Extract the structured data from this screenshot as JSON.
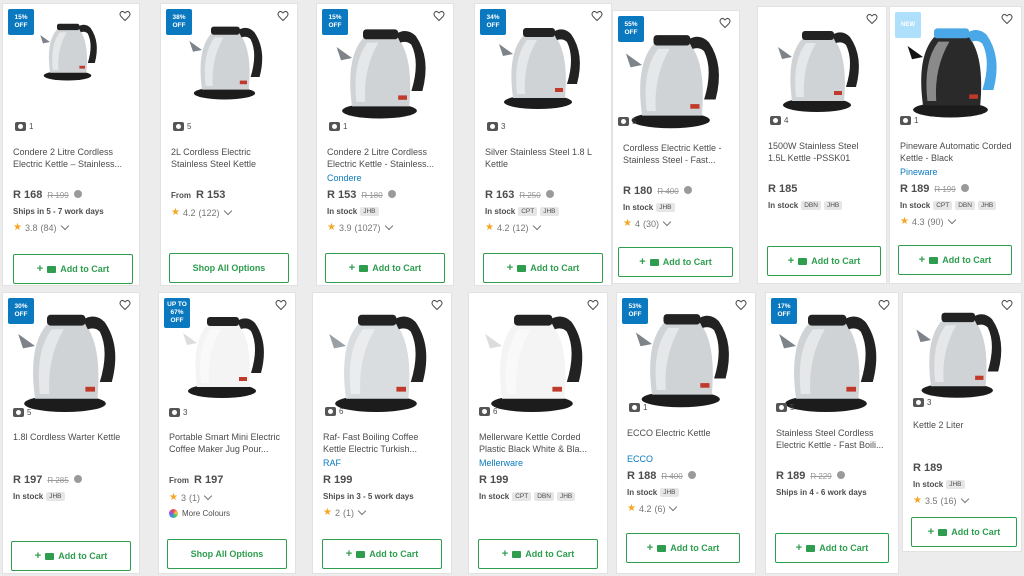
{
  "products": [
    {
      "badge": "15%\nOFF",
      "images": "1",
      "title": "Condere 2 Litre Cordless Electric Kettle – Stainless...",
      "brand": "",
      "from": "",
      "price": "R 168",
      "was": "R 199",
      "stock": "",
      "tags": [],
      "ships": "Ships in 5 - 7 work days",
      "rating": "3.8",
      "reviews": "(84)",
      "colours": "",
      "button": "Add to Cart"
    },
    {
      "badge": "38%\nOFF",
      "images": "5",
      "title": "2L Cordless Electric Stainless Steel Kettle",
      "brand": "",
      "from": "From",
      "price": "R 153",
      "was": "",
      "stock": "",
      "tags": [],
      "ships": "",
      "rating": "4.2",
      "reviews": "(122)",
      "colours": "",
      "button": "Shop All Options"
    },
    {
      "badge": "15%\nOFF",
      "images": "1",
      "title": "Condere 2 Litre Cordless Electric Kettle - Stainless...",
      "brand": "Condere",
      "from": "",
      "price": "R 153",
      "was": "R 180",
      "stock": "In stock",
      "tags": [
        "JHB"
      ],
      "ships": "",
      "rating": "3.9",
      "reviews": "(1027)",
      "colours": "",
      "button": "Add to Cart"
    },
    {
      "badge": "34%\nOFF",
      "images": "3",
      "title": "Silver Stainless Steel 1.8 L Kettle",
      "brand": "",
      "from": "",
      "price": "R 163",
      "was": "R 250",
      "stock": "In stock",
      "tags": [
        "CPT",
        "JHB"
      ],
      "ships": "",
      "rating": "4.2",
      "reviews": "(12)",
      "colours": "",
      "button": "Add to Cart"
    },
    {
      "badge": "55%\nOFF",
      "images": "5",
      "title": "Cordless Electric Kettle - Stainless Steel - Fast...",
      "brand": "",
      "from": "",
      "price": "R 180",
      "was": "R 400",
      "stock": "In stock",
      "tags": [
        "JHB"
      ],
      "ships": "",
      "rating": "4",
      "reviews": "(30)",
      "colours": "",
      "button": "Add to Cart"
    },
    {
      "badge": "",
      "images": "4",
      "title": "1500W Stainless Steel 1.5L Kettle -PSSK01",
      "brand": "",
      "from": "",
      "price": "R 185",
      "was": "",
      "stock": "In stock",
      "tags": [
        "DBN",
        "JHB"
      ],
      "ships": "",
      "rating": "",
      "reviews": "",
      "colours": "",
      "button": "Add to Cart"
    },
    {
      "badge": "NEW",
      "images": "1",
      "title": "Pineware Automatic Corded Kettle - Black",
      "brand": "Pineware",
      "from": "",
      "price": "R 189",
      "was": "R 199",
      "stock": "In stock",
      "tags": [
        "CPT",
        "DBN",
        "JHB"
      ],
      "ships": "",
      "rating": "4.3",
      "reviews": "(90)",
      "colours": "",
      "button": "Add to Cart"
    },
    {
      "badge": "30%\nOFF",
      "images": "5",
      "title": "1.8l Cordless Warter Kettle",
      "brand": "",
      "from": "",
      "price": "R 197",
      "was": "R 285",
      "stock": "In stock",
      "tags": [
        "JHB"
      ],
      "ships": "",
      "rating": "",
      "reviews": "",
      "colours": "",
      "button": "Add to Cart"
    },
    {
      "badge": "UP TO\n67%\nOFF",
      "images": "3",
      "title": "Portable Smart Mini Electric Coffee Maker Jug Pour...",
      "brand": "",
      "from": "From",
      "price": "R 197",
      "was": "",
      "stock": "",
      "tags": [],
      "ships": "",
      "rating": "3",
      "reviews": "(1)",
      "colours": "More Colours",
      "button": "Shop All Options"
    },
    {
      "badge": "",
      "images": "6",
      "title": "Raf- Fast Boiling Coffee Kettle Electric Turkish...",
      "brand": "RAF",
      "from": "",
      "price": "R 199",
      "was": "",
      "stock": "",
      "tags": [],
      "ships": "Ships in 3 - 5 work days",
      "rating": "2",
      "reviews": "(1)",
      "colours": "",
      "button": "Add to Cart"
    },
    {
      "badge": "",
      "images": "6",
      "title": "Mellerware Kettle Corded Plastic Black White & Bla...",
      "brand": "Mellerware",
      "from": "",
      "price": "R 199",
      "was": "",
      "stock": "In stock",
      "tags": [
        "CPT",
        "DBN",
        "JHB"
      ],
      "ships": "",
      "rating": "",
      "reviews": "",
      "colours": "",
      "button": "Add to Cart"
    },
    {
      "badge": "53%\nOFF",
      "images": "1",
      "title": "ECCO Electric Kettle",
      "brand": "ECCO",
      "from": "",
      "price": "R 188",
      "was": "R 400",
      "stock": "In stock",
      "tags": [
        "JHB"
      ],
      "ships": "",
      "rating": "4.2",
      "reviews": "(6)",
      "colours": "",
      "button": "Add to Cart"
    },
    {
      "badge": "17%\nOFF",
      "images": "5",
      "title": "Stainless Steel Cordless Electric Kettle - Fast Boili...",
      "brand": "",
      "from": "",
      "price": "R 189",
      "was": "R 229",
      "stock": "",
      "tags": [],
      "ships": "Ships in 4 - 6 work days",
      "rating": "",
      "reviews": "",
      "colours": "",
      "button": "Add to Cart"
    },
    {
      "badge": "",
      "images": "3",
      "title": "Kettle 2 Liter",
      "brand": "",
      "from": "",
      "price": "R 189",
      "was": "",
      "stock": "In stock",
      "tags": [
        "JHB"
      ],
      "ships": "",
      "rating": "3.5",
      "reviews": "(16)",
      "colours": "",
      "button": "Add to Cart"
    }
  ],
  "colors": {
    "accent": "#2e9d4e",
    "badge": "#0b79bf",
    "brand_link": "#0b79bf",
    "star": "#f5a623"
  },
  "icons": {
    "wishlist": "heart-icon",
    "images": "camera-icon",
    "cart": "cart-icon",
    "info": "info-icon",
    "expand": "chevron-down-icon"
  }
}
